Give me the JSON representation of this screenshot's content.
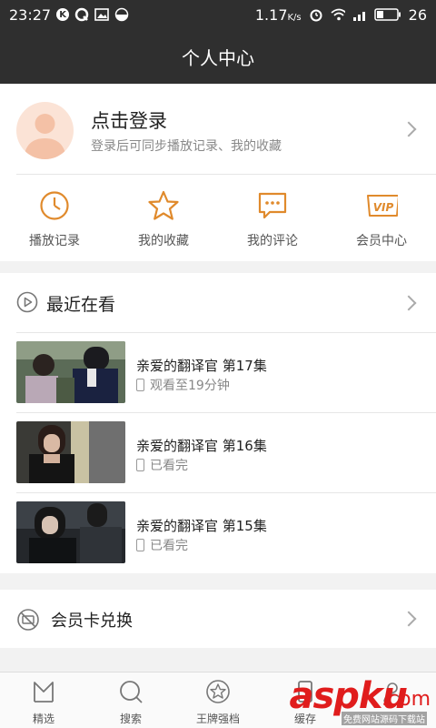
{
  "status_bar": {
    "time": "23:27",
    "speed": "1.17",
    "speed_unit": "K/s",
    "battery": "26",
    "left_icon_k": "K"
  },
  "header": {
    "title": "个人中心"
  },
  "profile": {
    "title": "点击登录",
    "subtitle": "登录后可同步播放记录、我的收藏"
  },
  "quick_actions": [
    {
      "label": "播放记录",
      "icon": "clock-icon"
    },
    {
      "label": "我的收藏",
      "icon": "star-icon"
    },
    {
      "label": "我的评论",
      "icon": "comment-icon"
    },
    {
      "label": "会员中心",
      "icon": "vip-icon",
      "icon_text": "VIP"
    }
  ],
  "recent": {
    "title": "最近在看",
    "items": [
      {
        "title": "亲爱的翻译官 第17集",
        "status": "观看至19分钟"
      },
      {
        "title": "亲爱的翻译官 第16集",
        "status": "已看完"
      },
      {
        "title": "亲爱的翻译官 第15集",
        "status": "已看完"
      }
    ]
  },
  "vip_card": {
    "title": "会员卡兑换"
  },
  "tabbar": [
    {
      "label": "精选",
      "icon": "featured-icon"
    },
    {
      "label": "搜索",
      "icon": "search-icon"
    },
    {
      "label": "王牌强档",
      "icon": "star-icon"
    },
    {
      "label": "缓存",
      "icon": "download-icon"
    },
    {
      "label": "",
      "icon": "profile-icon"
    }
  ],
  "watermark": {
    "brand": "aspku",
    "suffix": ".com",
    "sub": "免费网站源码下载站"
  },
  "colors": {
    "accent": "#e08a2c",
    "dark": "#2f2f2f"
  }
}
